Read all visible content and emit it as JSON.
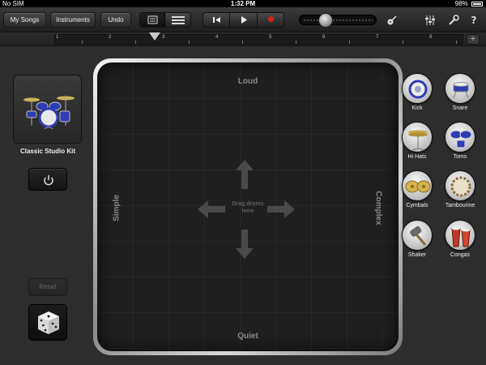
{
  "status_bar": {
    "carrier": "No SIM",
    "time": "1:32 PM",
    "battery": "98%"
  },
  "toolbar": {
    "my_songs": "My Songs",
    "instruments": "Instruments",
    "undo": "Undo"
  },
  "ruler": {
    "bars": [
      "1",
      "2",
      "3",
      "4",
      "5",
      "6",
      "7",
      "8"
    ],
    "plus": "+"
  },
  "kit": {
    "name": "Classic Studio Kit",
    "reset": "Reset"
  },
  "pad": {
    "top": "Loud",
    "bottom": "Quiet",
    "left": "Simple",
    "right": "Complex",
    "hint_line1": "Drag drums",
    "hint_line2": "here"
  },
  "instruments": [
    {
      "label": "Kick"
    },
    {
      "label": "Snare"
    },
    {
      "label": "Hi Hats"
    },
    {
      "label": "Toms"
    },
    {
      "label": "Cymbals"
    },
    {
      "label": "Tambourine"
    },
    {
      "label": "Shaker"
    },
    {
      "label": "Congas"
    }
  ],
  "colors": {
    "record": "#e02020",
    "drum_blue": "#2f3db3"
  }
}
